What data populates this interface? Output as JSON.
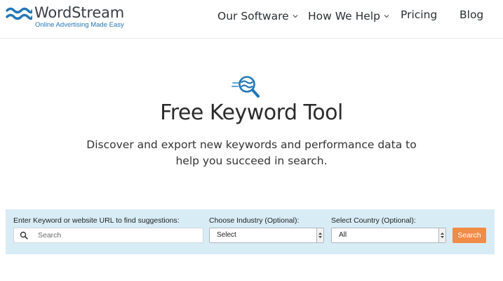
{
  "brand": {
    "name": "WordStream",
    "tagline": "Online Advertising Made Easy",
    "color": "#2376b7"
  },
  "nav": {
    "items": [
      {
        "label": "Our Software",
        "has_dropdown": true
      },
      {
        "label": "How We Help",
        "has_dropdown": true
      },
      {
        "label": "Pricing",
        "has_dropdown": false
      },
      {
        "label": "Blog",
        "has_dropdown": false
      }
    ]
  },
  "hero": {
    "icon": "keyword-magnifier-icon",
    "title": "Free Keyword Tool",
    "subtitle_line1": "Discover and export new keywords and performance data to",
    "subtitle_line2": "help you succeed in search."
  },
  "search_panel": {
    "keyword_label": "Enter Keyword or website URL to find suggestions:",
    "keyword_placeholder": "Search",
    "keyword_value": "",
    "industry_label": "Choose Industry (Optional):",
    "industry_value": "Select",
    "country_label": "Select Country (Optional):",
    "country_value": "All",
    "search_button_label": "Search",
    "panel_color": "#d8ecf6",
    "button_color": "#f08c46"
  }
}
